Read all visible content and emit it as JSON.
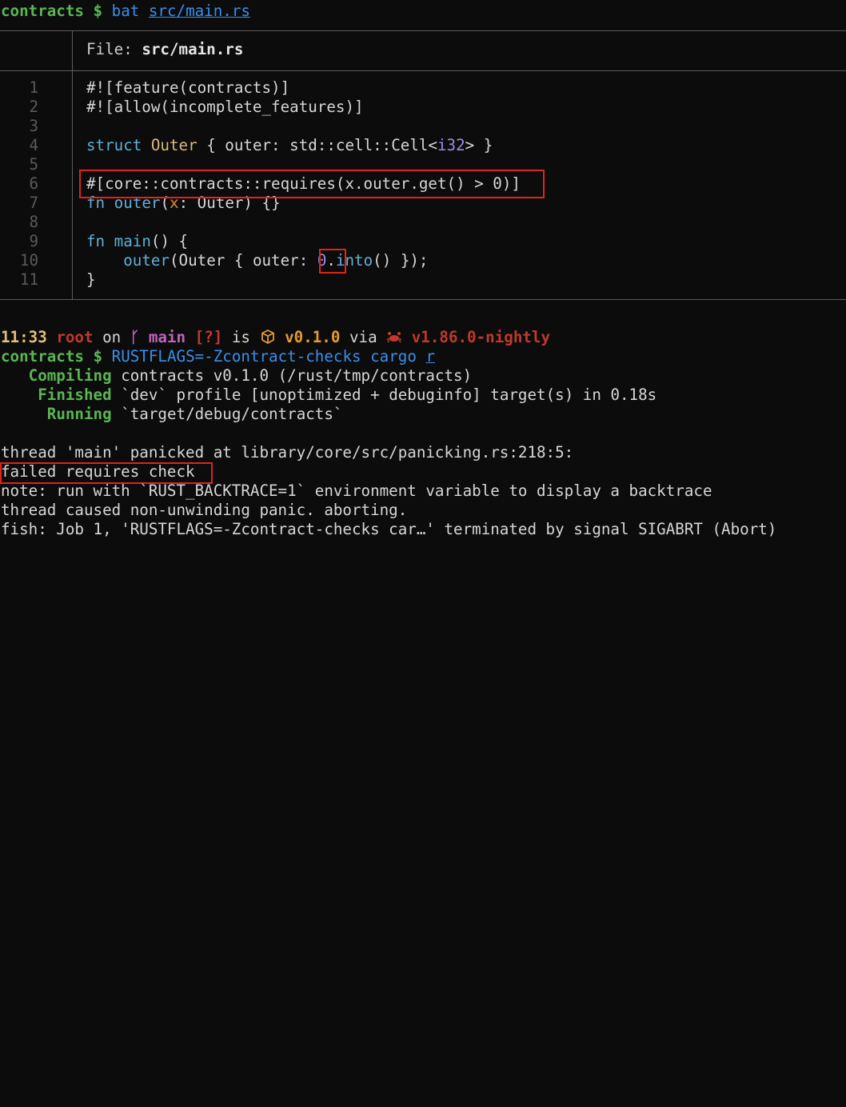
{
  "prompt1": {
    "dir": "contracts",
    "symbol": "$",
    "cmd": "bat",
    "arg": "src/main.rs"
  },
  "file_header": {
    "label": "File: ",
    "name": "src/main.rs"
  },
  "line_numbers": [
    "1",
    "2",
    "3",
    "4",
    "5",
    "6",
    "7",
    "8",
    "9",
    "10",
    "11"
  ],
  "code": {
    "l1": "#![feature(contracts)]",
    "l2": "#![allow(incomplete_features)]",
    "l4_kw": "struct",
    "l4_name": "Outer",
    "l4_a": " { outer: std::cell::Cell<",
    "l4_ty": "i32",
    "l4_b": "> }",
    "l6": "#[core::contracts::requires(x.outer.get() > 0)]",
    "l7_kw": "fn",
    "l7_fn": "outer",
    "l7_p1": "(",
    "l7_arg": "x",
    "l7_p2": ": Outer) {}",
    "l9_kw": "fn",
    "l9_fn": "main",
    "l9_rest": "() {",
    "l10_indent": "    ",
    "l10_fn": "outer",
    "l10_a": "(Outer { outer: ",
    "l10_num": "0",
    "l10_dot": ".",
    "l10_m": "into",
    "l10_b": "() });",
    "l11": "}"
  },
  "status": {
    "time": "11:33",
    "user": "root",
    "on": "on",
    "branch_icon": "git-branch-icon",
    "branch": "main",
    "flags": "[?]",
    "is": "is",
    "pkg_icon": "package-icon",
    "version": "v0.1.0",
    "via": "via",
    "rust_icon": "rust-crab-icon",
    "rust_version": "v1.86.0-nightly"
  },
  "prompt2": {
    "dir": "contracts",
    "symbol": "$",
    "env": "RUSTFLAGS=-Zcontract-checks",
    "cmd": "cargo",
    "sub": "r"
  },
  "cargo": {
    "compiling_label": "Compiling",
    "compiling_text": "contracts v0.1.0 (/rust/tmp/contracts)",
    "finished_label": "Finished",
    "finished_text": "`dev` profile [unoptimized + debuginfo] target(s) in 0.18s",
    "running_label": "Running",
    "running_text": "`target/debug/contracts`"
  },
  "panic": {
    "line1": "thread 'main' panicked at library/core/src/panicking.rs:218:5:",
    "line2": "failed requires check",
    "line3": "note: run with `RUST_BACKTRACE=1` environment variable to display a backtrace",
    "line4": "thread caused non-unwinding panic. aborting.",
    "line5": "fish: Job 1, 'RUSTFLAGS=-Zcontract-checks car…' terminated by signal SIGABRT (Abort)"
  },
  "colors": {
    "highlight_box": "#e0231b",
    "prompt_green": "#5ab552",
    "link_blue": "#3b8eea"
  }
}
